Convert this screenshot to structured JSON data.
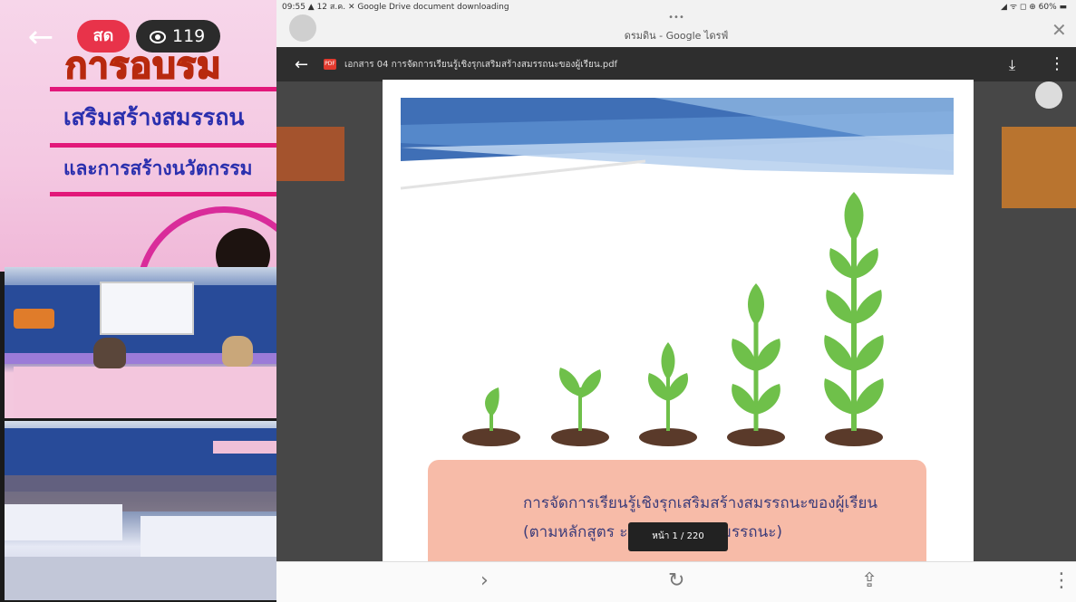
{
  "stream": {
    "live_label": "สด",
    "viewer_count": "119"
  },
  "banner": {
    "line1": "การอบรม",
    "line2": "เสริมสร้างสมรรถน",
    "line3": "และการสร้างนวัตกรรม"
  },
  "device": {
    "status_text": "09:55 ▲ 12 ส.ค.   ✕ Google Drive document downloading",
    "status_right": "◢ ᯤ ◻ ⊕ 60% ▬"
  },
  "browser": {
    "tab_title": "ดรมดิน - Google ไดรฟ์",
    "pdf_filename": "เอกสาร 04 การจัดการเรียนรู้เชิงรุกเสริมสร้างสมรรถนะของผู้เรียน.pdf"
  },
  "document": {
    "line1": "การจัดการเรียนรู้เชิงรุกเสริมสร้างสมรรถนะของผู้เรียน",
    "line2": "(ตามหลักสูตร                    ะหลักสูตรฐานสมรรถนะ)",
    "page_counter": "หน้า  1  /  220"
  },
  "colors": {
    "live_badge": "#e8334a",
    "banner_title": "#2a2fae",
    "textbox": "#f7bba8",
    "plant_green": "#6fc04a"
  }
}
